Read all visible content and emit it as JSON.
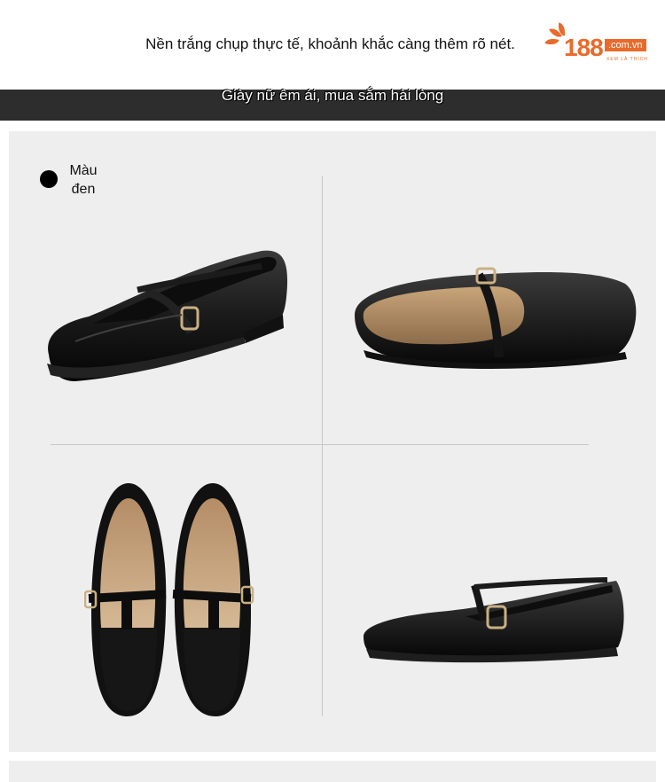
{
  "header": {
    "headline": "Nền trắng chụp thực tế, khoảnh khắc càng thêm rõ nét.",
    "logo": {
      "number": "188",
      "domain": ".com.vn",
      "tagline": "XEM LÀ THÍCH"
    }
  },
  "banner": {
    "text": "Giày nữ êm ái, mua sắm hài lòng"
  },
  "product": {
    "color_label": "Màu đen",
    "swatch_color": "#000000",
    "photos": [
      "side-view-left",
      "side-view-right-top",
      "top-view-pair",
      "side-view-right"
    ]
  },
  "colors": {
    "accent": "#e96a2b",
    "banner_bg": "#2d2d2d",
    "panel_bg": "#eeeeee"
  }
}
